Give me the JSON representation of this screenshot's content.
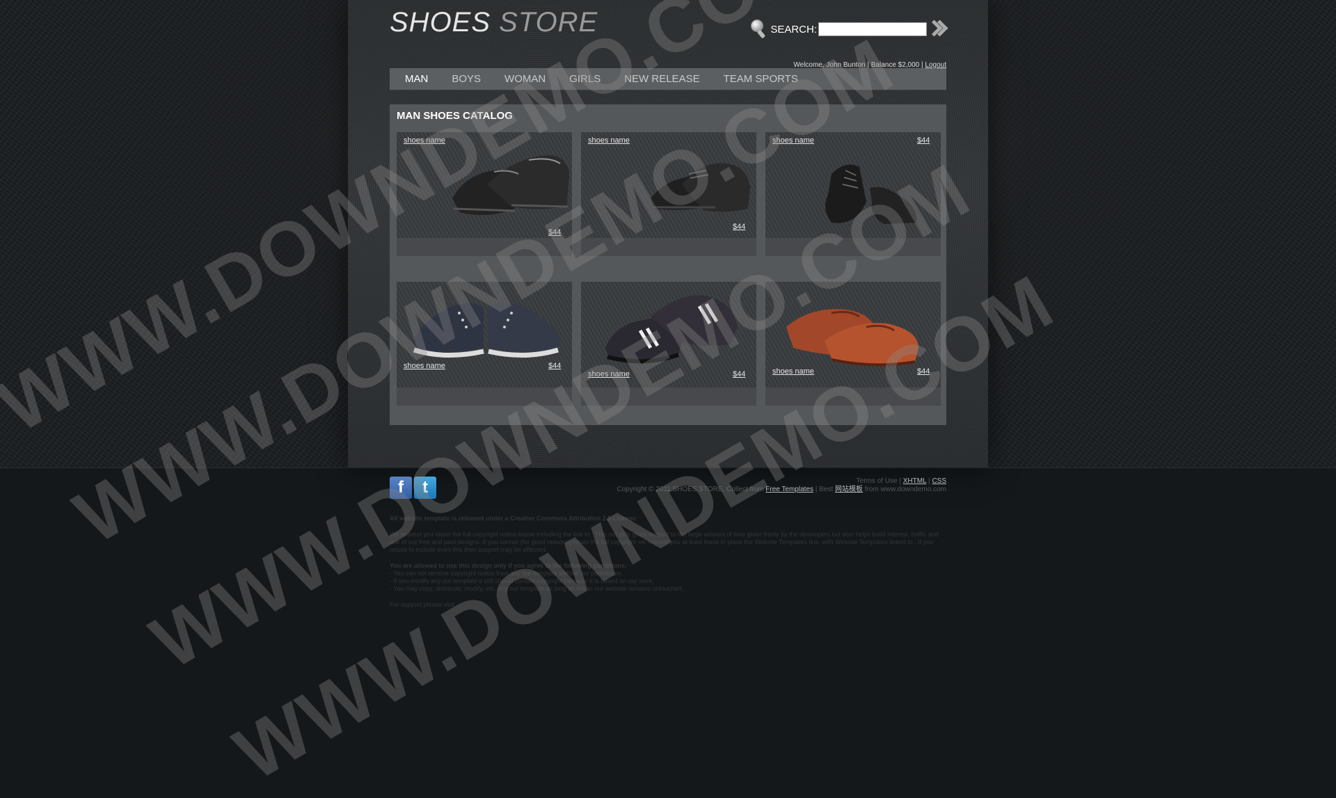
{
  "header": {
    "logo_part1": "SHOES",
    "logo_part2": "STORE",
    "search_label": "SEARCH:",
    "search_placeholder": "",
    "welcome_text": "Welcome, John Bunton | Balance $2,000 |",
    "logout_label": "Logout"
  },
  "nav": {
    "items": [
      {
        "label": "MAN",
        "active": true
      },
      {
        "label": "BOYS"
      },
      {
        "label": "WOMAN"
      },
      {
        "label": "GIRLS"
      },
      {
        "label": "NEW RELEASE"
      },
      {
        "label": "TEAM SPORTS"
      }
    ]
  },
  "catalog": {
    "title": "MAN SHOES CATALOG",
    "products": [
      {
        "name": "shoes name",
        "price": "$44",
        "image": "black-loafer-pair"
      },
      {
        "name": "shoes name",
        "price": "$44",
        "image": "black-derby-pair"
      },
      {
        "name": "shoes name",
        "price": "$44",
        "image": "black-oxford-pair"
      },
      {
        "name": "shoes name",
        "price": "$44",
        "image": "navy-sneaker-pair"
      },
      {
        "name": "shoes name",
        "price": "$44",
        "image": "black-sport-sneaker-pair"
      },
      {
        "name": "shoes name",
        "price": "$44",
        "image": "brown-loafer-pair"
      }
    ]
  },
  "footer": {
    "terms": "Terms of Use |",
    "xhtml": "XHTML",
    "sep": "|",
    "css": "CSS",
    "copyright": "Copyright © 2011 SHOES STORE. Collect from",
    "free_templates": "Free Templates",
    "best": "| Best",
    "chinese_link": "网站模板",
    "from": "from www.downdemo.com"
  },
  "license": {
    "title": "All website template is released under a Creative Commons Attribution 2.5 License",
    "para1": "We request you retain the full copyright notice below including the link to . This not only gives respect to the large amount of time given freely by the developers but also helps build interest, traffic and use of our free and paid designs. If you cannot (for good reasons) retain the full copyright we request you at least leave in place the Website Templates line, with Website Templates linked to . If you refuse to include even this then support may be affected.",
    "allowed": "You are allowed to use this design only if you agree to the following conditions:",
    "cond1": "- You can not remove copyright notice from any our template without our permission.",
    "cond2": "- If you modify any our template it still should contain copyright because it is based on our work.",
    "cond3": "- You may copy, distribute, modify, etc. any our template as long as link to our website remains untouched.",
    "support": "For support please visit"
  },
  "watermark": "WWW.DOWNDEMO.COM"
}
